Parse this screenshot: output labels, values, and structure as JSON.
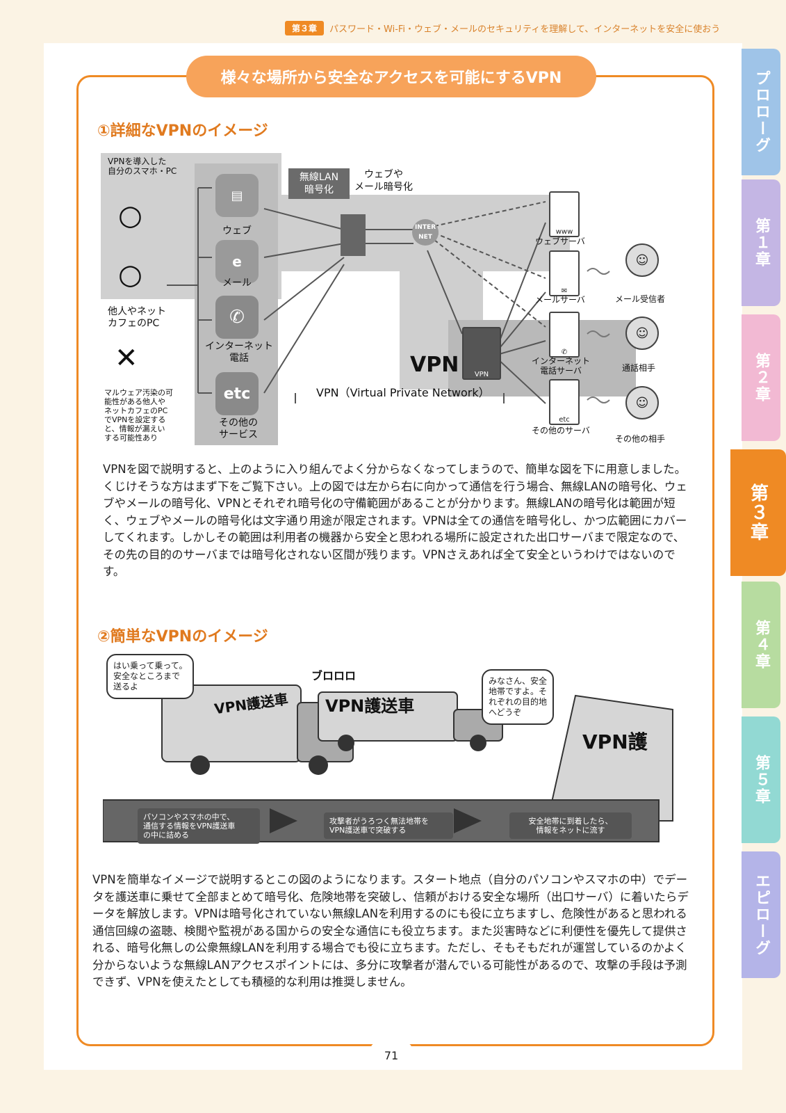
{
  "header": {
    "chapter_tag": "第３章",
    "title": "パスワード・Wi-Fi・ウェブ・メールのセキュリティを理解して、インターネットを安全に使おう"
  },
  "tabs": [
    {
      "label": "プロローグ",
      "color": "#9fc4e8"
    },
    {
      "label": "第１章",
      "color": "#c4b6e4"
    },
    {
      "label": "第２章",
      "color": "#f2b9d3"
    },
    {
      "label": "第３章",
      "color": "#ef8a24"
    },
    {
      "label": "第４章",
      "color": "#b7dca0"
    },
    {
      "label": "第５章",
      "color": "#92d9d3"
    },
    {
      "label": "エピローグ",
      "color": "#b4b4e8"
    }
  ],
  "title": "様々な場所から安全なアクセスを可能にするVPN",
  "section1": {
    "heading": "①詳細なVPNのイメージ",
    "fig": {
      "own_device": "VPNを導入した\n自分のスマホ・PC",
      "other_pc": "他人やネット\nカフェのPC",
      "malware_note": "マルウェア汚染の可\n能性がある他人や\nネットカフェのPC\nでVPNを設定する\nと、情報が漏えい\nする可能性あり",
      "wifi_enc": "無線LAN\n暗号化",
      "web_mail_enc": "ウェブや\nメール暗号化",
      "svc_web": "ウェブ",
      "svc_mail": "メール",
      "svc_phone": "インターネット\n電話",
      "svc_other": "その他の\nサービス",
      "internet": "INTER\nNET",
      "vpn_big": "VPN",
      "vpn_range": "VPN（Virtual Private Network）",
      "server_web": "ウェブサーバ",
      "server_mail": "メールサーバ",
      "server_phone": "インターネット\n電話サーバ",
      "server_other": "その他のサーバ",
      "peer_mail": "メール受信者",
      "peer_phone": "通話相手",
      "peer_other": "その他の相手",
      "icon_o": "○",
      "icon_x": "✕",
      "icon_etc": "etc",
      "icon_e": "e"
    },
    "text": "VPNを図で説明すると、上のように入り組んでよく分からなくなってしまうので、簡単な図を下に用意しました。くじけそうな方はまず下をご覧下さい。上の図では左から右に向かって通信を行う場合、無線LANの暗号化、ウェブやメールの暗号化、VPNとそれぞれ暗号化の守備範囲があることが分かります。無線LANの暗号化は範囲が短く、ウェブやメールの暗号化は文字通り用途が限定されます。VPNは全ての通信を暗号化し、かつ広範囲にカバーしてくれます。しかしその範囲は利用者の機器から安全と思われる場所に設定された出口サーバまで限定なので、その先の目的のサーバまでは暗号化されない区間が残ります。VPNさえあれば全て安全というわけではないのです。"
  },
  "section2": {
    "heading": "②簡単なVPNのイメージ",
    "fig": {
      "bubble1": "はい乗って乗って。\n安全なところまで\n送るよ",
      "bubble2": "みなさん、安全\n地帯ですよ。そ\nれぞれの目的地\nへどうぞ",
      "truck1": "VPN護送車",
      "truck2": "VPN護送車",
      "truck3": "VPN護",
      "sfx": "ブロロロ",
      "step1": "パソコンやスマホの中で、\n通信する情報をVPN護送車\nの中に詰める",
      "step2": "攻撃者がうろつく無法地帯を\nVPN護送車で突破する",
      "step3": "安全地帯に到着したら、\n情報をネットに流す"
    },
    "text": "VPNを簡単なイメージで説明するとこの図のようになります。スタート地点（自分のパソコンやスマホの中）でデータを護送車に乗せて全部まとめて暗号化、危険地帯を突破し、信頼がおける安全な場所（出口サーバ）に着いたらデータを解放します。VPNは暗号化されていない無線LANを利用するのにも役に立ちますし、危険性があると思われる通信回線の盗聴、検閲や監視がある国からの安全な通信にも役立ちます。また災害時などに利便性を優先して提供される、暗号化無しの公衆無線LANを利用する場合でも役に立ちます。ただし、そもそもだれが運営しているのかよく分からないような無線LANアクセスポイントには、多分に攻撃者が潜んでいる可能性があるので、攻撃の手段は予測できず、VPNを使えたとしても積極的な利用は推奨しません。"
  },
  "page_number": "71"
}
